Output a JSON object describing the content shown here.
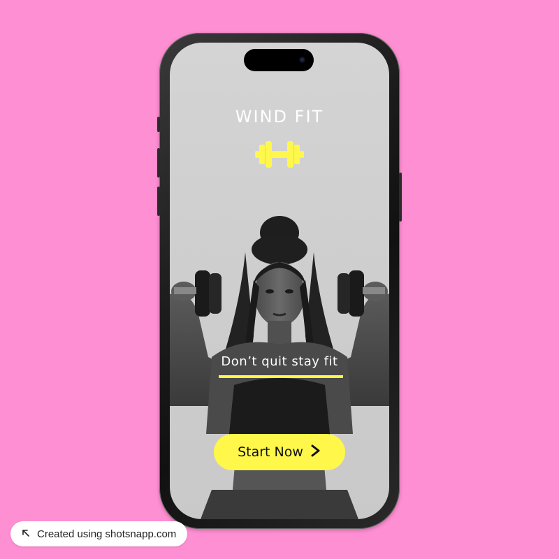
{
  "app": {
    "title": "WIND FIT",
    "logo_icon": "dumbbell-icon",
    "tagline": "Don’t quit stay fit",
    "cta_label": "Start Now",
    "cta_icon": "chevron-right-icon",
    "accent_color": "#fff74a",
    "background_color": "#ff8fd3"
  },
  "watermark": {
    "icon": "arrow-up-left-icon",
    "text": "Created using shotsnapp.com"
  }
}
